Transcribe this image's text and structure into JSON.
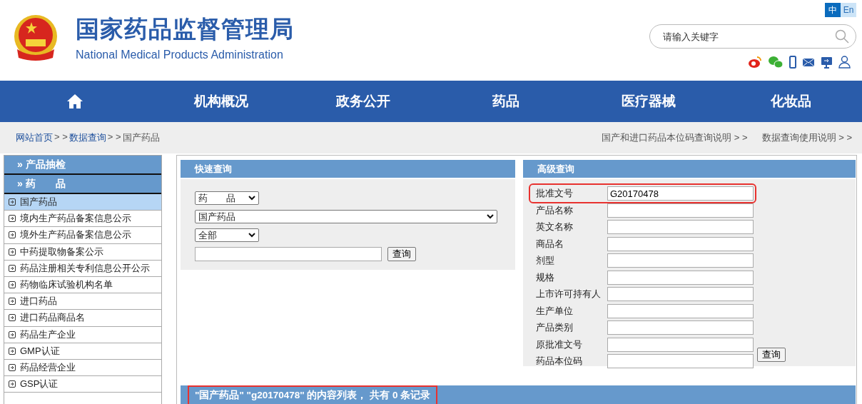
{
  "header": {
    "title": "国家药品监督管理局",
    "subtitle": "National Medical Products Administration",
    "languages": [
      {
        "label": "中",
        "selected": true
      },
      {
        "label": "En",
        "selected": false
      }
    ],
    "search": {
      "placeholder": "请输入关键字"
    }
  },
  "nav": [
    {
      "kind": "home"
    },
    {
      "kind": "text",
      "label": "机构概况"
    },
    {
      "kind": "text",
      "label": "政务公开"
    },
    {
      "kind": "text",
      "label": "药品"
    },
    {
      "kind": "text",
      "label": "医疗器械"
    },
    {
      "kind": "text",
      "label": "化妆品"
    }
  ],
  "breadcrumb": {
    "items": [
      {
        "label": "网站首页",
        "link": true
      },
      {
        "label": "数据查询",
        "link": true
      },
      {
        "label": "国产药品",
        "link": false
      }
    ],
    "separator": "> >",
    "links": [
      "国产和进口药品本位码查询说明 > >",
      "数据查询使用说明 > >"
    ]
  },
  "sidebar": {
    "headings": [
      "» 产品抽检",
      "» 药　　品"
    ],
    "items": [
      {
        "label": "国产药品",
        "selected": true
      },
      {
        "label": "境内生产药品备案信息公示",
        "selected": false
      },
      {
        "label": "境外生产药品备案信息公示",
        "selected": false
      },
      {
        "label": "中药提取物备案公示",
        "selected": false
      },
      {
        "label": "药品注册相关专利信息公开公示",
        "selected": false
      },
      {
        "label": "药物临床试验机构名单",
        "selected": false
      },
      {
        "label": "进口药品",
        "selected": false
      },
      {
        "label": "进口药品商品名",
        "selected": false
      },
      {
        "label": "药品生产企业",
        "selected": false
      },
      {
        "label": "GMP认证",
        "selected": false
      },
      {
        "label": "药品经营企业",
        "selected": false
      },
      {
        "label": "GSP认证",
        "selected": false
      }
    ]
  },
  "quick_query": {
    "title": "快速查询",
    "selects": [
      {
        "value": "药　　品"
      },
      {
        "value": "国产药品"
      },
      {
        "value": "全部"
      }
    ],
    "button": "查询"
  },
  "advanced_query": {
    "title": "高级查询",
    "fields": [
      {
        "label": "批准文号",
        "value": "G20170478",
        "highlighted": true
      },
      {
        "label": "产品名称",
        "highlighted": false
      },
      {
        "label": "英文名称",
        "highlighted": false
      },
      {
        "label": "商品名",
        "highlighted": false
      },
      {
        "label": "剂型",
        "highlighted": false
      },
      {
        "label": "规格",
        "highlighted": false
      },
      {
        "label": "上市许可持有人",
        "highlighted": false
      },
      {
        "label": "生产单位",
        "highlighted": false
      },
      {
        "label": "产品类别",
        "highlighted": false
      },
      {
        "label": "原批准文号",
        "highlighted": false
      },
      {
        "label": "药品本位码",
        "highlighted": false
      }
    ],
    "button": "查询"
  },
  "result": {
    "text": "\"国产药品\" \"g20170478\" 的内容列表， 共有 0 条记录",
    "highlighted": true
  }
}
